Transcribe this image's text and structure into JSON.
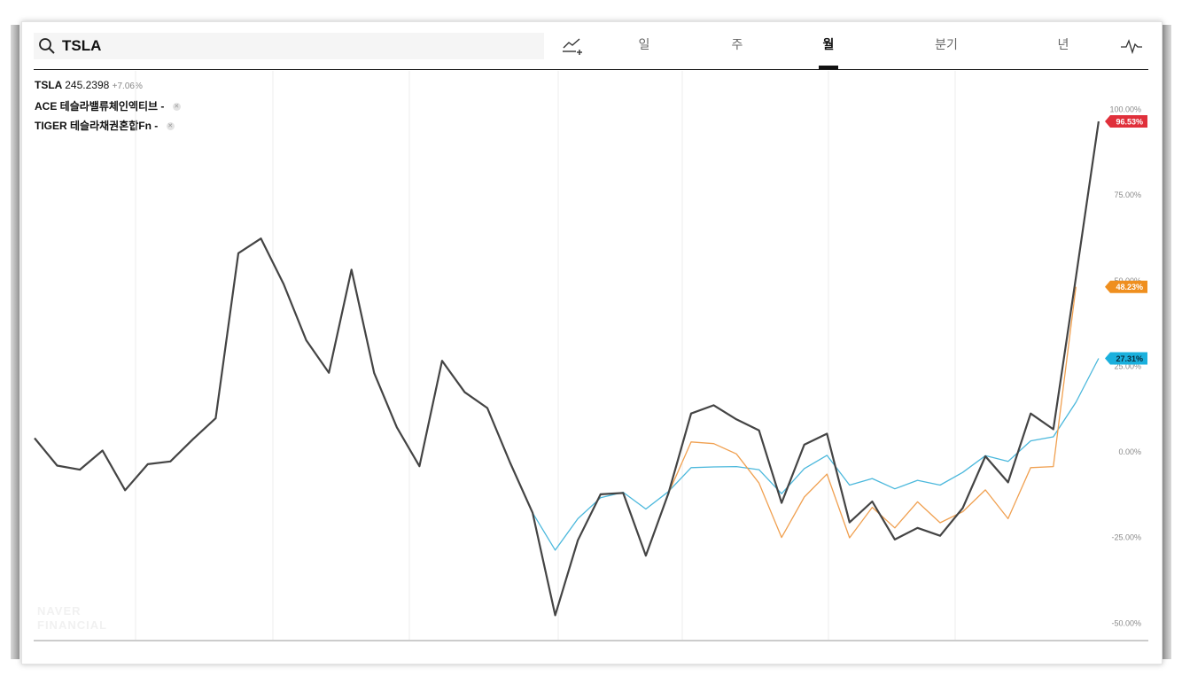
{
  "search": {
    "query": "TSLA"
  },
  "tabs": [
    {
      "label": "일",
      "active": false
    },
    {
      "label": "주",
      "active": false
    },
    {
      "label": "월",
      "active": true
    },
    {
      "label": "분기",
      "active": false
    },
    {
      "label": "년",
      "active": false
    }
  ],
  "icons": {
    "search": "search-icon",
    "compare": "add-compare-icon",
    "indicator": "pulse-icon",
    "close": "close-icon"
  },
  "legend": {
    "main": {
      "symbol": "TSLA",
      "price": "245.2398",
      "change": "+7.06%"
    },
    "items": [
      {
        "name": "ACE 테슬라밸류체인액티브",
        "value": "-"
      },
      {
        "name": "TIGER 테슬라채권혼합Fn",
        "value": "-"
      }
    ]
  },
  "watermark": {
    "line1": "NAVER",
    "line2": "FINANCIAL"
  },
  "colors": {
    "tsla": "#444444",
    "ace": "#f0a050",
    "tiger": "#4bb8dc",
    "badge_tsla": "#e0303b",
    "badge_ace": "#ef8f1f",
    "badge_tiger": "#1ab0dd"
  },
  "chart_data": {
    "type": "line",
    "x_unit": "month index",
    "ylim": [
      -50,
      100
    ],
    "y_ticks": [
      "100.00%",
      "75.00%",
      "50.00%",
      "25.00%",
      "0.00%",
      "-25.00%",
      "-50.00%"
    ],
    "grid": true,
    "series": [
      {
        "name": "TSLA",
        "start": 0,
        "last_label": "96.53%",
        "values": [
          4,
          -4,
          -5.2,
          0.4,
          -11.2,
          -3.6,
          -2.8,
          3.7,
          9.8,
          58,
          62.3,
          49,
          32.6,
          23.1,
          53.2,
          23,
          7.2,
          -4.2,
          26.6,
          17.4,
          12.8,
          -3.1,
          -17.8,
          -47.7,
          -25.8,
          -12.4,
          -12,
          -30.3,
          -12.1,
          11.2,
          13.6,
          9.5,
          6.3,
          -14.9,
          2.1,
          5.3,
          -20.6,
          -14.5,
          -25.6,
          -22.2,
          -24.5,
          -16.4,
          -1.3,
          -8.9,
          11.2,
          6.6,
          51,
          96.5
        ]
      },
      {
        "name": "ACE 테슬라밸류체인액티브",
        "start": 28,
        "last_label": "48.23%",
        "values": [
          -12.1,
          2.9,
          2.4,
          -0.6,
          -9.1,
          -25,
          -13.2,
          -6.5,
          -25.1,
          -16.2,
          -22.2,
          -14.6,
          -20.7,
          -17.5,
          -11.1,
          -19.5,
          -4.6,
          -4.3,
          48.2
        ]
      },
      {
        "name": "TIGER 테슬라채권혼합Fn",
        "start": 22,
        "last_label": "27.31%",
        "values": [
          -17.8,
          -28.7,
          -19.5,
          -13.4,
          -11.8,
          -16.7,
          -11.6,
          -4.6,
          -4.4,
          -4.3,
          -5.2,
          -12.2,
          -4.9,
          -1,
          -9.7,
          -7.8,
          -10.8,
          -8.3,
          -9.7,
          -6,
          -1.1,
          -2.8,
          3.2,
          4.4,
          14.5,
          27.3
        ]
      }
    ]
  }
}
